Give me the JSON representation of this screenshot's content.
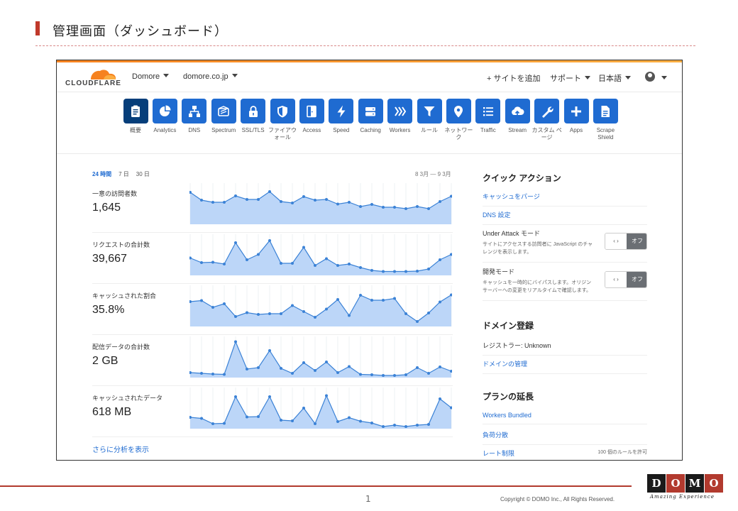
{
  "slide": {
    "title": "管理画面（ダッシュボード）",
    "page_number": "1",
    "copyright": "Copyright © DOMO Inc., All Rights Reserved.",
    "logo_letters": [
      "D",
      "O",
      "M",
      "O"
    ],
    "logo_tagline": "Amazing Experience",
    "accent_color": "#b23a2e"
  },
  "nav": {
    "logo_text": "CLOUDFLARE",
    "account": "Domore",
    "domain": "domore.co.jp",
    "add_site": "+ サイトを追加",
    "support": "サポート",
    "language": "日本語",
    "user_icon": "user-circle-icon"
  },
  "apps": [
    {
      "label": "概要",
      "icon": "clipboard-icon",
      "active": true
    },
    {
      "label": "Analytics",
      "icon": "pie-chart-icon"
    },
    {
      "label": "DNS",
      "icon": "network-icon"
    },
    {
      "label": "Spectrum",
      "icon": "spectrum-icon"
    },
    {
      "label": "SSL/TLS",
      "icon": "lock-icon"
    },
    {
      "label": "ファイアウォール",
      "icon": "shield-icon"
    },
    {
      "label": "Access",
      "icon": "door-icon"
    },
    {
      "label": "Speed",
      "icon": "bolt-icon"
    },
    {
      "label": "Caching",
      "icon": "server-icon"
    },
    {
      "label": "Workers",
      "icon": "workers-icon"
    },
    {
      "label": "ルール",
      "icon": "filter-icon"
    },
    {
      "label": "ネットワーク",
      "icon": "location-pin-icon"
    },
    {
      "label": "Traffic",
      "icon": "list-icon"
    },
    {
      "label": "Stream",
      "icon": "cloud-upload-icon"
    },
    {
      "label": "カスタム ページ",
      "icon": "wrench-icon"
    },
    {
      "label": "Apps",
      "icon": "plus-icon"
    },
    {
      "label": "Scrape Shield",
      "icon": "document-icon"
    }
  ],
  "analytics": {
    "ranges": [
      "24 時間",
      "7 日",
      "30 日"
    ],
    "active_range": "24 時間",
    "date_range": "8 3月 — 9 3月",
    "more_link": "さらに分析を表示",
    "metrics": [
      {
        "label": "一意の訪問者数",
        "value": "1,645",
        "series": [
          0.86,
          0.64,
          0.58,
          0.58,
          0.76,
          0.66,
          0.66,
          0.88,
          0.6,
          0.56,
          0.74,
          0.64,
          0.66,
          0.53,
          0.58,
          0.46,
          0.52,
          0.44,
          0.44,
          0.4,
          0.46,
          0.4,
          0.6,
          0.75
        ]
      },
      {
        "label": "リクエストの合計数",
        "value": "39,667",
        "series": [
          0.45,
          0.32,
          0.33,
          0.28,
          0.88,
          0.4,
          0.55,
          0.94,
          0.3,
          0.3,
          0.75,
          0.24,
          0.43,
          0.24,
          0.28,
          0.18,
          0.1,
          0.07,
          0.07,
          0.07,
          0.08,
          0.14,
          0.4,
          0.55
        ]
      },
      {
        "label": "キャッシュされた割合",
        "value": "35.8%",
        "series": [
          0.66,
          0.69,
          0.5,
          0.6,
          0.24,
          0.35,
          0.3,
          0.32,
          0.32,
          0.55,
          0.38,
          0.22,
          0.45,
          0.72,
          0.27,
          0.84,
          0.7,
          0.7,
          0.75,
          0.32,
          0.1,
          0.34,
          0.65,
          0.85
        ]
      },
      {
        "label": "配信データの合計数",
        "value": "2 GB",
        "series": [
          0.1,
          0.08,
          0.06,
          0.05,
          0.97,
          0.2,
          0.24,
          0.72,
          0.22,
          0.08,
          0.38,
          0.16,
          0.4,
          0.1,
          0.27,
          0.05,
          0.04,
          0.02,
          0.02,
          0.04,
          0.24,
          0.08,
          0.26,
          0.14
        ]
      },
      {
        "label": "キャッシュされたデータ",
        "value": "618 MB",
        "series": [
          0.28,
          0.25,
          0.1,
          0.11,
          0.86,
          0.29,
          0.3,
          0.86,
          0.2,
          0.18,
          0.54,
          0.1,
          0.89,
          0.16,
          0.27,
          0.17,
          0.12,
          0.02,
          0.06,
          0.02,
          0.06,
          0.08,
          0.8,
          0.55
        ]
      }
    ]
  },
  "side": {
    "quick_actions_title": "クイック アクション",
    "purge_cache": "キャッシュをパージ",
    "dns_settings": "DNS 設定",
    "under_attack_label": "Under Attack モード",
    "under_attack_desc": "サイトにアクセスする訪問者に JavaScript のチャレンジを表示します。",
    "dev_mode_label": "開発モード",
    "dev_mode_desc": "キャッシュを一時的にバイパスします。オリジン サーバーへの変更をリアルタイムで確認します。",
    "toggle_off": "オフ",
    "toggle_arrows": "‹ ›",
    "domain_title": "ドメイン登録",
    "registrar": "レジストラー: Unknown",
    "domain_manage": "ドメインの管理",
    "plan_title": "プランの延長",
    "workers_bundled": "Workers Bundled",
    "load_balancing": "負荷分散",
    "rate_limiting": "レート制限",
    "rate_limit_note": "100 個のルールを許可"
  },
  "colors": {
    "cf_blue": "#1f6bd1",
    "cf_blue_active": "#063e7a",
    "spark_fill": "#bcd6f8",
    "spark_line": "#3b82d6"
  }
}
